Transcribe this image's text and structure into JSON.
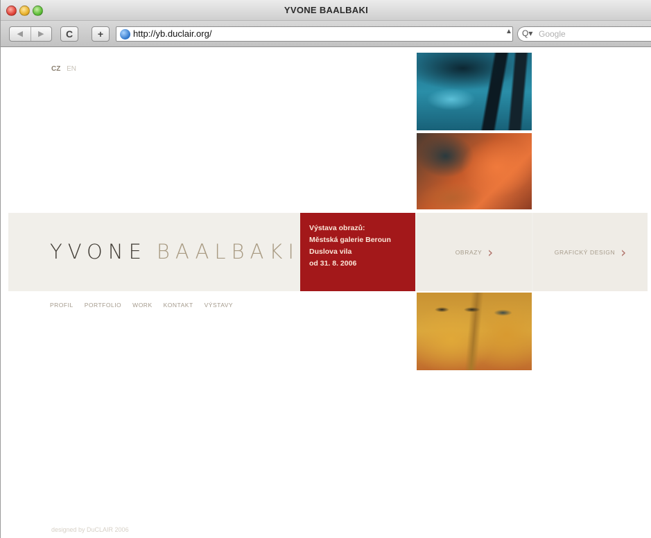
{
  "window": {
    "title": "YVONE BAALBAKI"
  },
  "toolbar": {
    "back_glyph": "◀",
    "forward_glyph": "▶",
    "reload_glyph": "C",
    "add_glyph": "+",
    "url": "http://yb.duclair.org/",
    "search_icon": "Q▾",
    "search_placeholder": "Google"
  },
  "lang": {
    "cz": "CZ",
    "en": "EN"
  },
  "logo": {
    "first": "YVONE",
    "last": "BAALBAKI"
  },
  "promo": {
    "lines": [
      "Výstava obrazů:",
      "Městská galerie Beroun",
      "Duslova vila",
      "od 31. 8. 2006"
    ]
  },
  "tiles": {
    "obrazy": "OBRAZY",
    "graficky": "GRAFICKÝ DESIGN"
  },
  "nav": {
    "items": [
      "PROFIL",
      "PORTFOLIO",
      "WORK",
      "KONTAKT",
      "VÝSTAVY"
    ]
  },
  "footer": {
    "text": "designed by DuCLAIR 2006"
  },
  "colors": {
    "promo_bg": "#a3181a",
    "band_bg": "#f1efea",
    "accent_chevron": "#b0736a"
  },
  "icons": {
    "paintings": [
      "painting-blue-icon",
      "painting-red-icon",
      "painting-yellow-faces-icon"
    ]
  }
}
